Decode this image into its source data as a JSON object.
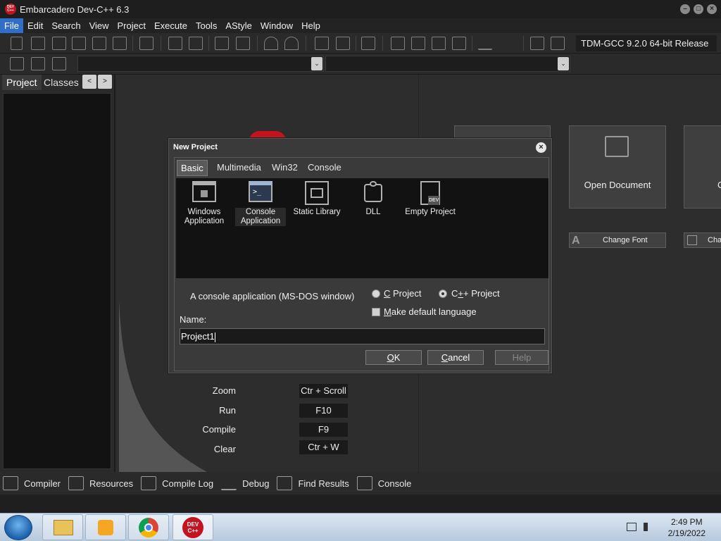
{
  "window": {
    "title": "Embarcadero Dev-C++ 6.3",
    "app_icon_text": "DEV C++"
  },
  "menu": [
    "File",
    "Edit",
    "Search",
    "View",
    "Project",
    "Execute",
    "Tools",
    "AStyle",
    "Window",
    "Help"
  ],
  "toolbar": {
    "compiler": "TDM-GCC 9.2.0 64-bit Release",
    "combo_arrow": "⌄"
  },
  "left_panel": {
    "tabs": [
      "Project",
      "Classes"
    ],
    "prev": "<",
    "next": ">"
  },
  "welcome": {
    "cards": [
      "Open Document"
    ],
    "cut_card_label": "C",
    "buttons": [
      "Change Font",
      "Cha"
    ],
    "shortcuts": [
      {
        "label": "Zoom",
        "key": "Ctr + Scroll"
      },
      {
        "label": "Run",
        "key": "F10"
      },
      {
        "label": "Compile",
        "key": "F9"
      },
      {
        "label": "Clear",
        "key": "Ctr + W"
      }
    ]
  },
  "dialog": {
    "title": "New Project",
    "close": "×",
    "tabs": [
      "Basic",
      "Multimedia",
      "Win32",
      "Console"
    ],
    "items": [
      {
        "label1": "Windows",
        "label2": "Application",
        "icon": "windows-app-icon"
      },
      {
        "label1": "Console",
        "label2": "Application",
        "icon": "console-app-icon"
      },
      {
        "label1": "Static Library",
        "label2": "",
        "icon": "static-library-icon"
      },
      {
        "label1": "DLL",
        "label2": "",
        "icon": "dll-puzzle-icon"
      },
      {
        "label1": "Empty Project",
        "label2": "",
        "icon": "empty-project-icon"
      }
    ],
    "console_icon_text": ">_",
    "empty_icon_text": "DEV",
    "selected_item": "Console Application",
    "description": "A console application (MS-DOS window)",
    "c_project": {
      "u": "C",
      "rest": " Project"
    },
    "cpp_project": {
      "pre": "C",
      "u": "+",
      "rest": "+ Project"
    },
    "default_language": {
      "u": "M",
      "rest": "ake default language"
    },
    "language_selected": "C++ Project",
    "make_default_checked": false,
    "name_label": "Name:",
    "name_value": "Project1",
    "ok": {
      "u": "O",
      "rest": "K"
    },
    "cancel": {
      "u": "C",
      "rest": "ancel"
    },
    "help": "Help"
  },
  "bottom_tabs": [
    "Compiler",
    "Resources",
    "Compile Log",
    "Debug",
    "Find Results",
    "Console"
  ],
  "taskbar": {
    "time": "2:49 PM",
    "date": "2/19/2022",
    "dev_icon_text": "DEV C++"
  },
  "colors": {
    "accent": "#2f6fc9",
    "devcpp_red": "#c2131e"
  }
}
